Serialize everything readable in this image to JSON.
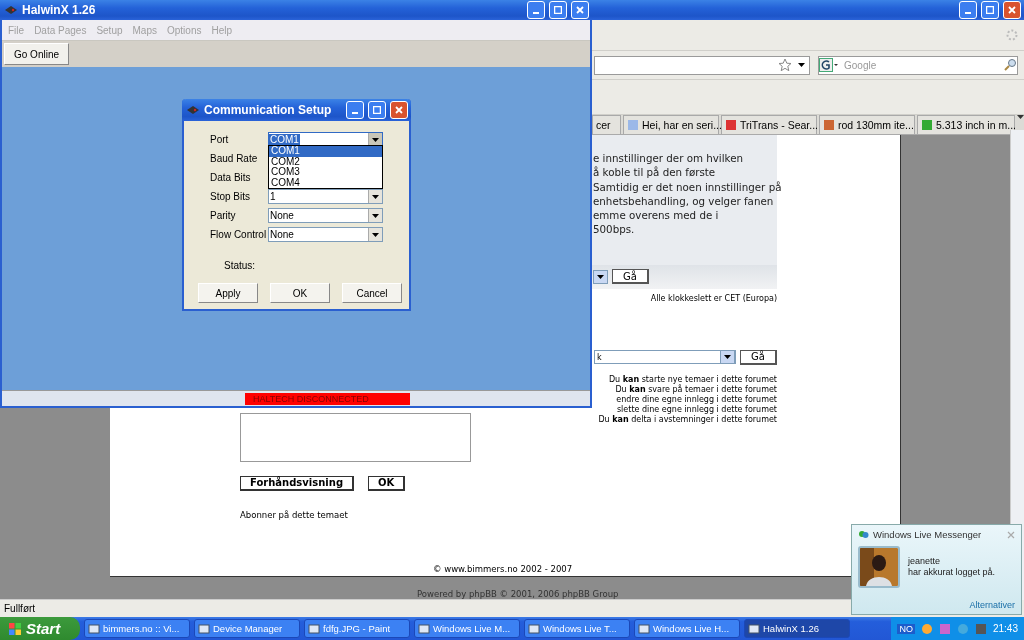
{
  "browser": {
    "search_placeholder": "Google",
    "tabs": [
      {
        "label": "cer",
        "selected": false
      },
      {
        "label": "Hei, har en seri...",
        "selected": false
      },
      {
        "label": "TriTrans - Sear...",
        "selected": false
      },
      {
        "label": "rod 130mm ite...",
        "selected": false
      },
      {
        "label": "5.313 inch in m...",
        "selected": false
      }
    ],
    "content": {
      "intro_lines": [
        "e innstillinger der om hvilken",
        "å koble til på den første",
        "Samtidig er det noen innstillinger på",
        "enhetsbehandling, og velger fanen",
        "emme overens med de i",
        "500bps."
      ],
      "go_button": "Gå",
      "timezone": "Alle klokkeslett er CET (Europa)",
      "jump_select": "k",
      "jump_go_button": "Gå",
      "permissions": [
        "Du **kan** starte nye temaer i dette forumet",
        "Du **kan** svare på temaer i dette forumet",
        "endre dine egne innlegg i dette forumet",
        "slette dine egne innlegg i dette forumet",
        "Du **kan** delta i avstemninger i dette forumet"
      ],
      "preview_button": "Forhåndsvisning",
      "ok_button": "OK",
      "subscribe_link": "Abonner på dette temaet",
      "copyright": "© www.bimmers.no 2002 - 2007",
      "powered_by": "Powered by phpBB © 2001, 2006 phpBB Group"
    },
    "status_bar": "Fullført"
  },
  "halwin": {
    "title": "HalwinX 1.26",
    "menu": [
      {
        "label": "File",
        "disabled": true
      },
      {
        "label": "Data Pages",
        "disabled": true
      },
      {
        "label": "Setup",
        "disabled": true
      },
      {
        "label": "Maps",
        "disabled": true
      },
      {
        "label": "Options",
        "disabled": true
      },
      {
        "label": "Help",
        "disabled": true
      }
    ],
    "go_online_button": "Go Online",
    "status": "HALTECH DISCONNECTED"
  },
  "dialog": {
    "title": "Communication Setup",
    "fields": [
      {
        "label": "Port",
        "value": "COM1",
        "focused": true,
        "open": true,
        "options": [
          {
            "label": "COM1",
            "selected": true
          },
          {
            "label": "COM2",
            "selected": false
          },
          {
            "label": "COM3",
            "selected": false
          },
          {
            "label": "COM4",
            "selected": false
          }
        ]
      },
      {
        "label": "Baud Rate"
      },
      {
        "label": "Data Bits"
      },
      {
        "label": "Stop Bits",
        "value": "1",
        "focused": false
      },
      {
        "label": "Parity",
        "value": "None",
        "focused": false
      },
      {
        "label": "Flow Control",
        "value": "None",
        "focused": false
      }
    ],
    "status_label": "Status:",
    "buttons": [
      "Apply",
      "OK",
      "Cancel"
    ]
  },
  "messenger": {
    "title": "Windows Live Messenger",
    "contact": "jeanette",
    "message": "har akkurat logget på.",
    "options_link": "Alternativer"
  },
  "taskbar": {
    "start": "Start",
    "items": [
      {
        "label": "bimmers.no :: Vi...",
        "selected": false
      },
      {
        "label": "Device Manager",
        "selected": false
      },
      {
        "label": "fdfg.JPG - Paint",
        "selected": false
      },
      {
        "label": "Windows Live M...",
        "selected": false
      },
      {
        "label": "Windows Live T...",
        "selected": false
      },
      {
        "label": "Windows Live H...",
        "selected": false
      },
      {
        "label": "HalwinX 1.26",
        "selected": true
      }
    ],
    "language": "NO",
    "clock": "21:43"
  }
}
